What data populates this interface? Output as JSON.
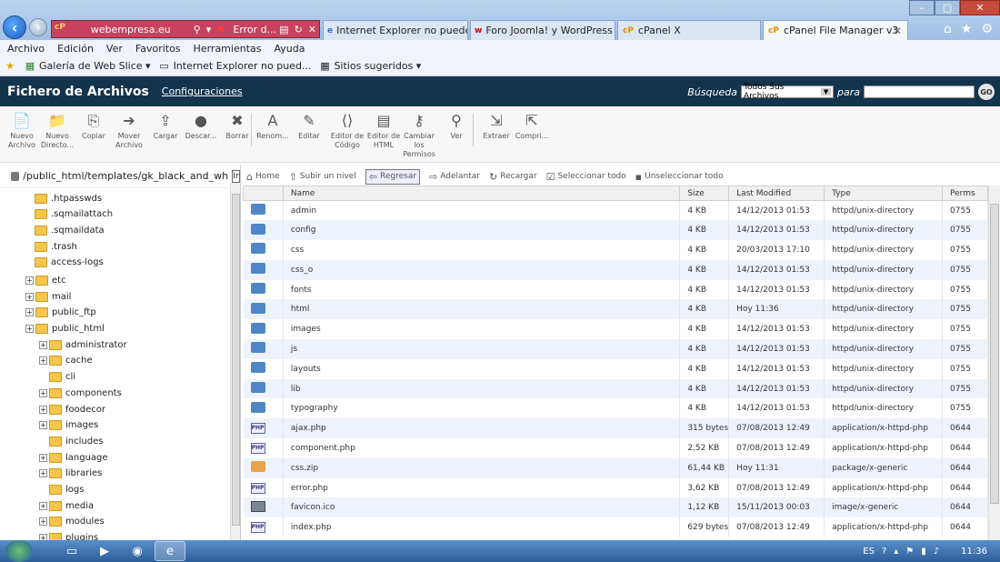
{
  "browser": {
    "address_url": "webempresa.eu",
    "address_error": "Error d...",
    "tabs": [
      {
        "label": "Internet Explorer no puede mo...",
        "icon": "ie-icon"
      },
      {
        "label": "Foro Joomla! y WordPress :: Te...",
        "icon": "webempresa-icon"
      },
      {
        "label": "cPanel X",
        "icon": "cpanel-icon"
      },
      {
        "label": "cPanel File Manager v3",
        "icon": "cpanel-icon"
      }
    ],
    "menu": [
      "Archivo",
      "Edición",
      "Ver",
      "Favoritos",
      "Herramientas",
      "Ayuda"
    ],
    "favorites": [
      {
        "label": "Galería de Web Slice ▾",
        "icon": "web-slice-icon"
      },
      {
        "label": "Internet Explorer no pued...",
        "icon": "ie-page-icon"
      },
      {
        "label": "Sitios sugeridos ▾",
        "icon": "suggested-sites-icon"
      }
    ]
  },
  "cpanel": {
    "title": "Fichero de Archivos",
    "config_link": "Configuraciones",
    "search_label": "Búsqueda",
    "search_scope": "Todos Sus Archivos",
    "search_para": "para",
    "go_label": "GO"
  },
  "toolbar": [
    {
      "label": "Nuevo Archivo",
      "icon": "new-file-icon",
      "glyph": "📄"
    },
    {
      "label": "Nuevo Directo...",
      "icon": "new-folder-icon",
      "glyph": "📁"
    },
    {
      "label": "Copiar",
      "icon": "copy-icon",
      "glyph": "⎘"
    },
    {
      "label": "Mover Archivo",
      "icon": "move-file-icon",
      "glyph": "➔"
    },
    {
      "label": "Cargar",
      "icon": "upload-icon",
      "glyph": "⇪"
    },
    {
      "label": "Descar...",
      "icon": "download-icon",
      "glyph": "●"
    },
    {
      "label": "Borrar",
      "icon": "delete-icon",
      "glyph": "✖"
    },
    {
      "label": "Renom...",
      "icon": "rename-icon",
      "glyph": "A"
    },
    {
      "label": "Editar",
      "icon": "edit-icon",
      "glyph": "✎"
    },
    {
      "label": "Editor de Código",
      "icon": "code-editor-icon",
      "glyph": "⟨⟩"
    },
    {
      "label": "Editor de HTML",
      "icon": "html-editor-icon",
      "glyph": "▤"
    },
    {
      "label": "Cambiar los Permisos",
      "icon": "permissions-icon",
      "glyph": "⚷"
    },
    {
      "label": "Ver",
      "icon": "view-icon",
      "glyph": "⚲"
    },
    {
      "label": "Extraer",
      "icon": "extract-icon",
      "glyph": "⇲"
    },
    {
      "label": "Compri...",
      "icon": "compress-icon",
      "glyph": "⇱"
    }
  ],
  "tree": {
    "path": "/public_html/templates/gk_black_and_wh",
    "go_label": "Ir",
    "items": [
      {
        "label": ".htpasswds",
        "level": 1,
        "expandable": false
      },
      {
        "label": ".sqmailattach",
        "level": 1,
        "expandable": false
      },
      {
        "label": ".sqmaildata",
        "level": 1,
        "expandable": false
      },
      {
        "label": ".trash",
        "level": 1,
        "expandable": false
      },
      {
        "label": "access-logs",
        "level": 1,
        "expandable": false
      },
      {
        "label": "etc",
        "level": 0,
        "expandable": true
      },
      {
        "label": "mail",
        "level": 0,
        "expandable": true
      },
      {
        "label": "public_ftp",
        "level": 0,
        "expandable": true
      },
      {
        "label": "public_html",
        "level": 0,
        "expandable": true
      },
      {
        "label": "administrator",
        "level": 2,
        "expandable": true
      },
      {
        "label": "cache",
        "level": 2,
        "expandable": true
      },
      {
        "label": "cli",
        "level": 3,
        "expandable": false
      },
      {
        "label": "components",
        "level": 2,
        "expandable": true
      },
      {
        "label": "foodecor",
        "level": 2,
        "expandable": true
      },
      {
        "label": "images",
        "level": 2,
        "expandable": true
      },
      {
        "label": "includes",
        "level": 3,
        "expandable": false
      },
      {
        "label": "language",
        "level": 2,
        "expandable": true
      },
      {
        "label": "libraries",
        "level": 2,
        "expandable": true
      },
      {
        "label": "logs",
        "level": 3,
        "expandable": false
      },
      {
        "label": "media",
        "level": 2,
        "expandable": true
      },
      {
        "label": "modules",
        "level": 2,
        "expandable": true
      },
      {
        "label": "plugins",
        "level": 2,
        "expandable": true
      }
    ]
  },
  "nav_actions": [
    {
      "label": "Home",
      "icon": "home-icon",
      "glyph": "⌂"
    },
    {
      "label": "Subir un nivel",
      "icon": "up-level-icon",
      "glyph": "⇧"
    },
    {
      "label": "Regresar",
      "icon": "back-arrow-icon",
      "glyph": "⇦"
    },
    {
      "label": "Adelantar",
      "icon": "forward-arrow-icon",
      "glyph": "⇨"
    },
    {
      "label": "Recargar",
      "icon": "reload-icon",
      "glyph": "↻"
    },
    {
      "label": "Seleccionar todo",
      "icon": "select-all-icon",
      "glyph": "☑"
    },
    {
      "label": "Unseleccionar todo",
      "icon": "unselect-all-icon",
      "glyph": "▪"
    }
  ],
  "table": {
    "columns": [
      "",
      "Name",
      "Size",
      "Last Modified",
      "Type",
      "Perms"
    ],
    "rows": [
      {
        "kind": "folder",
        "name": "admin",
        "size": "4 KB",
        "modified": "14/12/2013 01:53",
        "type": "httpd/unix-directory",
        "perms": "0755"
      },
      {
        "kind": "folder",
        "name": "config",
        "size": "4 KB",
        "modified": "14/12/2013 01:53",
        "type": "httpd/unix-directory",
        "perms": "0755"
      },
      {
        "kind": "folder",
        "name": "css",
        "size": "4 KB",
        "modified": "20/03/2013 17:10",
        "type": "httpd/unix-directory",
        "perms": "0755"
      },
      {
        "kind": "folder",
        "name": "css_o",
        "size": "4 KB",
        "modified": "14/12/2013 01:53",
        "type": "httpd/unix-directory",
        "perms": "0755"
      },
      {
        "kind": "folder",
        "name": "fonts",
        "size": "4 KB",
        "modified": "14/12/2013 01:53",
        "type": "httpd/unix-directory",
        "perms": "0755"
      },
      {
        "kind": "folder",
        "name": "html",
        "size": "4 KB",
        "modified": "Hoy 11:36",
        "type": "httpd/unix-directory",
        "perms": "0755"
      },
      {
        "kind": "folder",
        "name": "images",
        "size": "4 KB",
        "modified": "14/12/2013 01:53",
        "type": "httpd/unix-directory",
        "perms": "0755"
      },
      {
        "kind": "folder",
        "name": "js",
        "size": "4 KB",
        "modified": "14/12/2013 01:53",
        "type": "httpd/unix-directory",
        "perms": "0755"
      },
      {
        "kind": "folder",
        "name": "layouts",
        "size": "4 KB",
        "modified": "14/12/2013 01:53",
        "type": "httpd/unix-directory",
        "perms": "0755"
      },
      {
        "kind": "folder",
        "name": "lib",
        "size": "4 KB",
        "modified": "14/12/2013 01:53",
        "type": "httpd/unix-directory",
        "perms": "0755"
      },
      {
        "kind": "folder",
        "name": "typography",
        "size": "4 KB",
        "modified": "14/12/2013 01:53",
        "type": "httpd/unix-directory",
        "perms": "0755"
      },
      {
        "kind": "php",
        "name": "ajax.php",
        "size": "315 bytes",
        "modified": "07/08/2013 12:49",
        "type": "application/x-httpd-php",
        "perms": "0644"
      },
      {
        "kind": "php",
        "name": "component.php",
        "size": "2,52 KB",
        "modified": "07/08/2013 12:49",
        "type": "application/x-httpd-php",
        "perms": "0644"
      },
      {
        "kind": "zip",
        "name": "css.zip",
        "size": "61,44 KB",
        "modified": "Hoy 11:31",
        "type": "package/x-generic",
        "perms": "0644"
      },
      {
        "kind": "php",
        "name": "error.php",
        "size": "3,62 KB",
        "modified": "07/08/2013 12:49",
        "type": "application/x-httpd-php",
        "perms": "0644"
      },
      {
        "kind": "img",
        "name": "favicon.ico",
        "size": "1,12 KB",
        "modified": "15/11/2013 00:03",
        "type": "image/x-generic",
        "perms": "0644"
      },
      {
        "kind": "php",
        "name": "index.php",
        "size": "629 bytes",
        "modified": "07/08/2013 12:49",
        "type": "application/x-httpd-php",
        "perms": "0644"
      }
    ]
  },
  "taskbar": {
    "lang": "ES",
    "clock": "11:36"
  }
}
